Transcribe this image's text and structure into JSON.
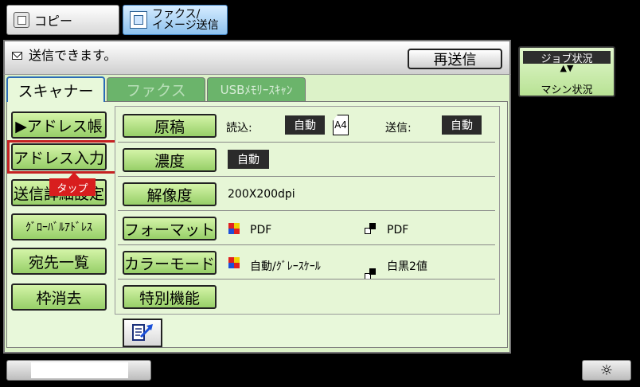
{
  "top_tabs": {
    "copy_label": "コピー",
    "fax_label_line1": "ファクス/",
    "fax_label_line2": "イメージ送信"
  },
  "status": {
    "message": "送信できます。",
    "resend_label": "再送信"
  },
  "job_status": {
    "top_label": "ジョブ状況",
    "arrows": "▲▼",
    "bottom_label": "マシン状況"
  },
  "tabs": [
    {
      "label": "スキャナー",
      "active": true
    },
    {
      "label": "ファクス",
      "active": false
    },
    {
      "label": "USBﾒﾓﾘｰｽｷｬﾝ",
      "active": false
    }
  ],
  "left_buttons": [
    {
      "label": "▶アドレス帳"
    },
    {
      "label": "アドレス入力"
    },
    {
      "label": "送信詳細設定"
    },
    {
      "label": "ｸﾞﾛｰﾊﾞﾙｱﾄﾞﾚｽ"
    },
    {
      "label": "宛先一覧"
    },
    {
      "label": "枠消去"
    }
  ],
  "tooltip": {
    "label": "タップ"
  },
  "settings": {
    "original": {
      "button": "原稿",
      "read_label": "読込:",
      "read_value": "自動",
      "paper_size": "A4",
      "send_label": "送信:",
      "send_value": "自動"
    },
    "density": {
      "button": "濃度",
      "value": "自動"
    },
    "resolution": {
      "button": "解像度",
      "value": "200X200dpi"
    },
    "format": {
      "button": "フォーマット",
      "color_value": "PDF",
      "bw_value": "PDF"
    },
    "color_mode": {
      "button": "カラーモード",
      "color_value": "自動/ｸﾞﾚｰｽｹｰﾙ",
      "bw_value": "白黒2値"
    },
    "special": {
      "button": "特別機能"
    }
  },
  "icons": {
    "brightness": "☼"
  }
}
